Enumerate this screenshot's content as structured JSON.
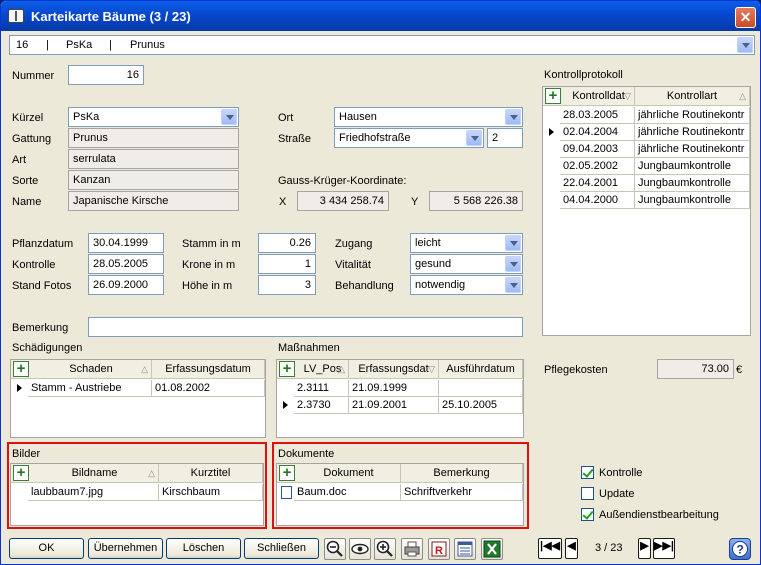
{
  "window": {
    "title": "Karteikarte Bäume  (3 / 23)",
    "close": "✕"
  },
  "header_combo": {
    "id": "16",
    "sep1": "|",
    "kuerzel": "PsKa",
    "sep2": "|",
    "gattung": "Prunus"
  },
  "fields": {
    "nummer_label": "Nummer",
    "nummer": "16",
    "kuerzel_label": "Kürzel",
    "kuerzel": "PsKa",
    "gattung_label": "Gattung",
    "gattung": "Prunus",
    "art_label": "Art",
    "art": "serrulata",
    "sorte_label": "Sorte",
    "sorte": "Kanzan",
    "name_label": "Name",
    "name": "Japanische Kirsche",
    "ort_label": "Ort",
    "ort": "Hausen",
    "strasse_label": "Straße",
    "strasse": "Friedhofstraße",
    "hausnr": "2",
    "gk_label": "Gauss-Krüger-Koordinate:",
    "x_label": "X",
    "x": "3 434 258.74",
    "y_label": "Y",
    "y": "5 568 226.38",
    "pflanzdatum_label": "Pflanzdatum",
    "pflanzdatum": "30.04.1999",
    "kontrolle_label": "Kontrolle",
    "kontrolle": "28.05.2005",
    "standfotos_label": "Stand Fotos",
    "standfotos": "26.09.2000",
    "stamm_label": "Stamm in m",
    "stamm": "0.26",
    "krone_label": "Krone  in m",
    "krone": "1",
    "hoehe_label": "Höhe  in m",
    "hoehe": "3",
    "zugang_label": "Zugang",
    "zugang": "leicht",
    "vitalitaet_label": "Vitalität",
    "vitalitaet": "gesund",
    "behandlung_label": "Behandlung",
    "behandlung": "notwendig",
    "bemerkung_label": "Bemerkung",
    "bemerkung": ""
  },
  "kontrollprotokoll": {
    "label": "Kontrollprotokoll",
    "columns": [
      "Kontrolldat",
      "Kontrollart"
    ],
    "rows": [
      [
        "28.03.2005",
        "jährliche Routinekontr"
      ],
      [
        "02.04.2004",
        "jährliche Routinekontr"
      ],
      [
        "09.04.2003",
        "jährliche Routinekontr"
      ],
      [
        "02.05.2002",
        "Jungbaumkontrolle"
      ],
      [
        "22.04.2001",
        "Jungbaumkontrolle"
      ],
      [
        "04.04.2000",
        "Jungbaumkontrolle"
      ]
    ]
  },
  "schaedigungen": {
    "label": "Schädigungen",
    "columns": [
      "Schaden",
      "Erfassungsdatum"
    ],
    "rows": [
      [
        "Stamm - Austriebe",
        "01.08.2002"
      ]
    ]
  },
  "massnahmen": {
    "label": "Maßnahmen",
    "columns": [
      "LV_Pos",
      "Erfassungsdat",
      "Ausführdatum"
    ],
    "rows": [
      [
        "2.3111",
        "21.09.1999",
        ""
      ],
      [
        "2.3730",
        "21.09.2001",
        "25.10.2005"
      ]
    ]
  },
  "bilder": {
    "label": "Bilder",
    "columns": [
      "Bildname",
      "Kurztitel"
    ],
    "rows": [
      [
        "laubbaum7.jpg",
        "Kirschbaum"
      ]
    ]
  },
  "dokumente": {
    "label": "Dokumente",
    "columns": [
      "Dokument",
      "Bemerkung"
    ],
    "rows": [
      [
        "Baum.doc",
        "Schriftverkehr"
      ]
    ]
  },
  "pflegekosten": {
    "label": "Pflegekosten",
    "value": "73.00",
    "unit": "€"
  },
  "checkboxes": [
    {
      "label": "Kontrolle",
      "checked": true
    },
    {
      "label": "Update",
      "checked": false
    },
    {
      "label": "Außendienstbearbeitung",
      "checked": true
    }
  ],
  "buttons": {
    "ok": "OK",
    "uebernehmen": "Übernehmen",
    "loeschen": "Löschen",
    "schliessen": "Schließen"
  },
  "nav": {
    "first": "|◀◀",
    "prev": "◀",
    "position": "3 / 23",
    "next": "▶",
    "last": "▶▶|"
  },
  "icons": [
    "zoom-out-icon",
    "eye-icon",
    "zoom-in-icon",
    "print-icon",
    "report-icon",
    "form-icon",
    "excel-icon",
    "help-icon"
  ],
  "colors": {
    "highlight_border": "#e01010",
    "titlebar": "#0a5fe6"
  }
}
